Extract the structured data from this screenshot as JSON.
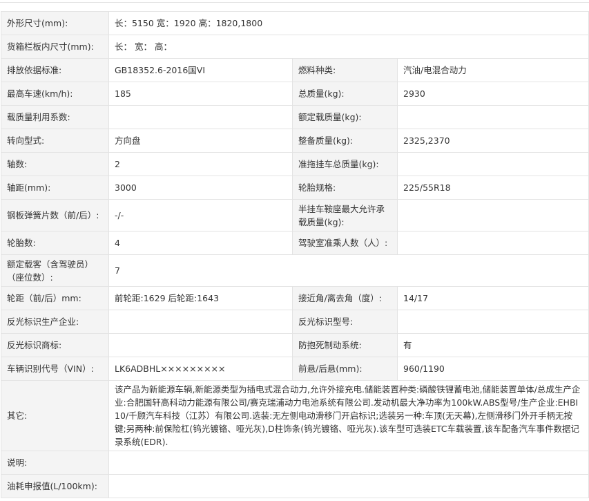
{
  "rows": [
    {
      "label": "外形尺寸(mm):",
      "value": "长：5150 宽：1920 高：1820,1800",
      "full": true
    },
    {
      "label": "货箱栏板内尺寸(mm):",
      "value": "长：  宽：  高：",
      "full": true
    },
    {
      "label": "排放依据标准:",
      "value": "GB18352.6-2016国VI",
      "label2": "燃料种类:",
      "value2": "汽油/电混合动力"
    },
    {
      "label": "最高车速(km/h):",
      "value": "185",
      "label2": "总质量(kg):",
      "value2": "2930"
    },
    {
      "label": "载质量利用系数:",
      "value": "",
      "label2": "额定载质量(kg):",
      "value2": ""
    },
    {
      "label": "转向型式:",
      "value": "方向盘",
      "label2": "整备质量(kg):",
      "value2": "2325,2370"
    },
    {
      "label": "轴数:",
      "value": "2",
      "label2": "准拖挂车总质量(kg):",
      "value2": ""
    },
    {
      "label": "轴距(mm):",
      "value": "3000",
      "label2": "轮胎规格:",
      "value2": "225/55R18"
    },
    {
      "label": "钢板弹簧片数（前/后）:",
      "value": "-/-",
      "label2": "半挂车鞍座最大允许承载质量(kg):",
      "value2": ""
    },
    {
      "label": "轮胎数:",
      "value": "4",
      "label2": "驾驶室准乘人数（人）:",
      "value2": ""
    },
    {
      "label": "额定载客（含驾驶员）（座位数）:",
      "value": "7",
      "full": true
    },
    {
      "label": "轮距（前/后）mm:",
      "value": "前轮距:1629 后轮距:1643",
      "label2": "接近角/离去角（度）:",
      "value2": "14/17"
    },
    {
      "label": "反光标识生产企业:",
      "value": "",
      "label2": "反光标识型号:",
      "value2": ""
    },
    {
      "label": "反光标识商标:",
      "value": "",
      "label2": "防抱死制动系统:",
      "value2": "有"
    },
    {
      "label": "车辆识别代号（VIN）:",
      "value": "LK6ADBHL×××××××××",
      "label2": "前悬/后悬(mm):",
      "value2": "960/1190"
    },
    {
      "label": "其它:",
      "value": "该产品为新能源车辆,新能源类型为插电式混合动力,允许外接充电.储能装置种类:磷酸铁锂蓄电池,储能装置单体/总成生产企业:合肥国轩高科动力能源有限公司/赛克瑞浦动力电池系统有限公司.发动机最大净功率为100kW.ABS型号/生产企业:EHBI 10/千顾汽车科技（江苏）有限公司.选装:无左侧电动滑移门开启标识;选装另一种:车顶(无天幕),左侧滑移门外开手柄无按键;另两种:前保险杠(钨光镀铬、哑光灰),D柱饰条(钨光镀铬、哑光灰).该车型可选装ETC车载装置,该车配备汽车事件数据记录系统(EDR).",
      "full": true
    },
    {
      "label": "说明:",
      "value": "",
      "full": true
    },
    {
      "label": "油耗申报值(L/100km):",
      "value": "",
      "full": true
    }
  ]
}
